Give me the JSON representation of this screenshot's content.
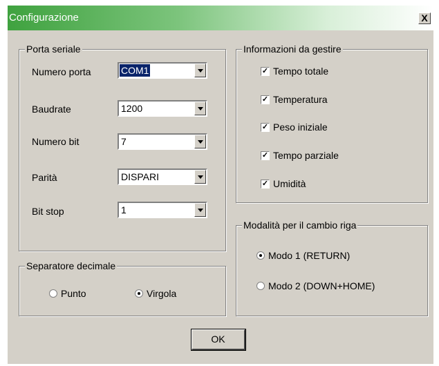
{
  "window": {
    "title": "Configurazione",
    "close_label": "X"
  },
  "serial_port": {
    "legend": "Porta seriale",
    "fields": [
      {
        "label": "Numero porta",
        "value": "COM1"
      },
      {
        "label": "Baudrate",
        "value": "1200"
      },
      {
        "label": "Numero bit",
        "value": "7"
      },
      {
        "label": "Parità",
        "value": "DISPARI"
      },
      {
        "label": "Bit stop",
        "value": "1"
      }
    ]
  },
  "info": {
    "legend": "Informazioni da gestire",
    "items": [
      {
        "label": "Tempo totale",
        "checked": true
      },
      {
        "label": "Temperatura",
        "checked": true
      },
      {
        "label": "Peso iniziale",
        "checked": true
      },
      {
        "label": "Tempo parziale",
        "checked": true
      },
      {
        "label": "Umidità",
        "checked": true
      }
    ]
  },
  "decimal": {
    "legend": "Separatore decimale",
    "options": [
      {
        "label": "Punto",
        "selected": false
      },
      {
        "label": "Virgola",
        "selected": true
      }
    ]
  },
  "line_mode": {
    "legend": "Modalità per il cambio riga",
    "options": [
      {
        "label": "Modo 1 (RETURN)",
        "selected": true
      },
      {
        "label": "Modo 2 (DOWN+HOME)",
        "selected": false
      }
    ]
  },
  "ok_label": "OK",
  "colors": {
    "title_start": "#3fa23f",
    "face": "#d4d0c8",
    "selection": "#0a246a"
  }
}
